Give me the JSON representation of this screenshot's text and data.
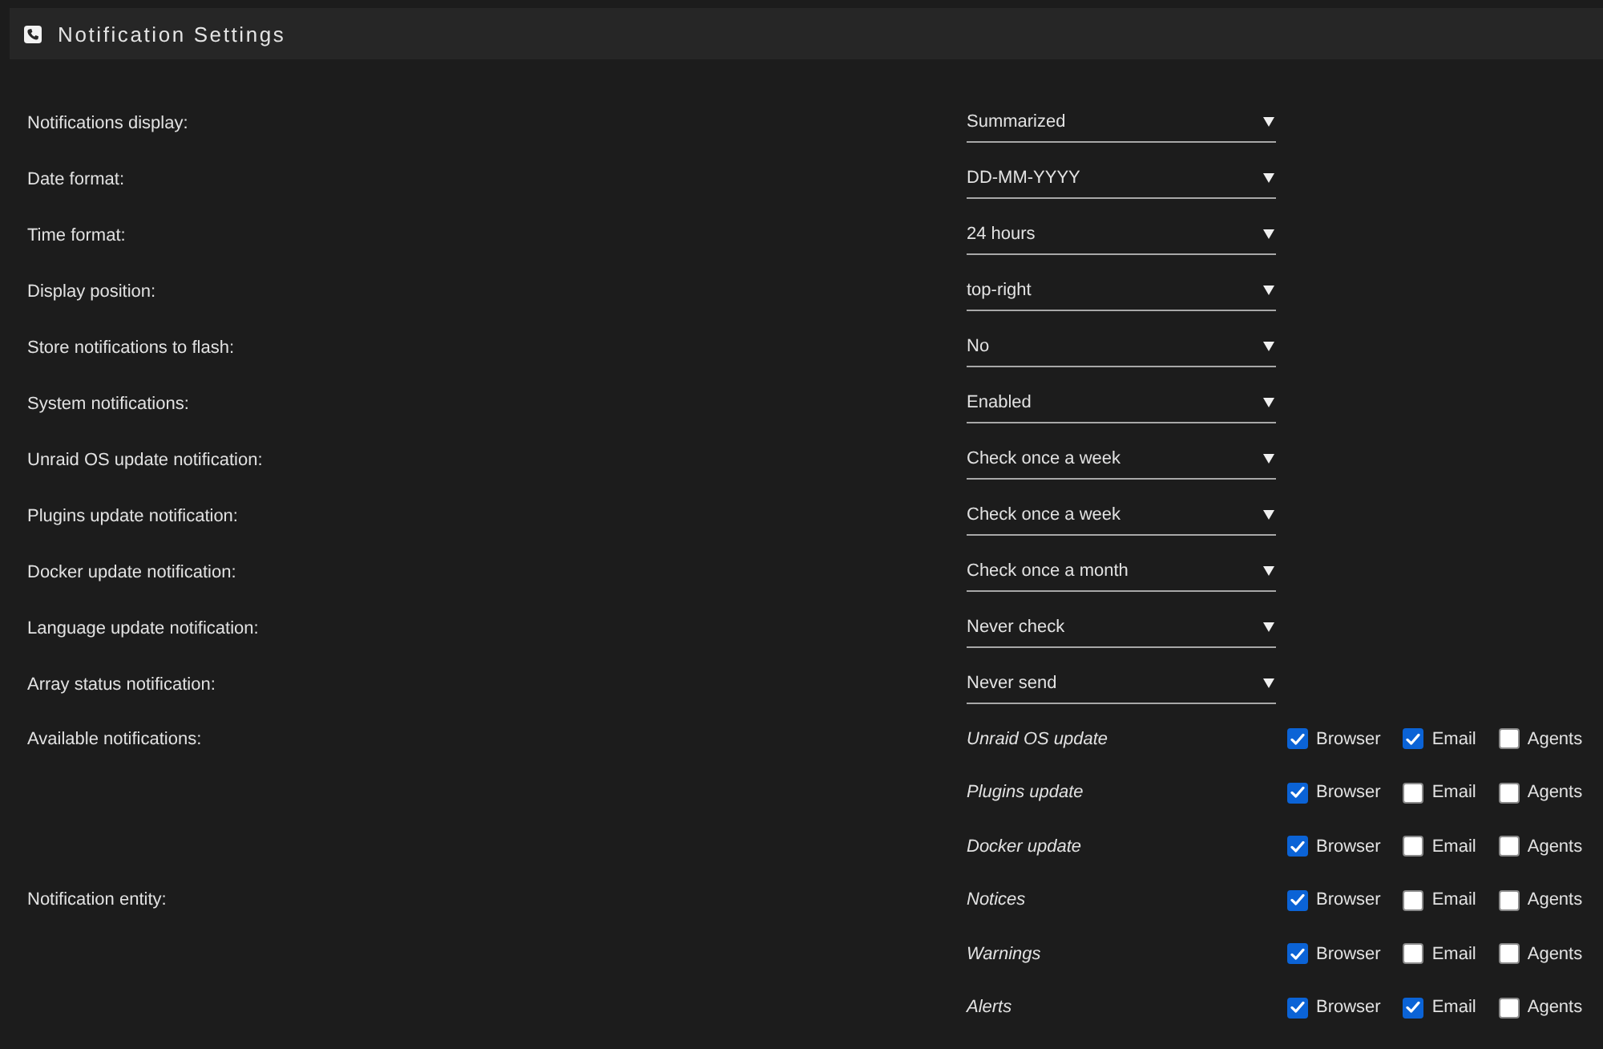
{
  "header": {
    "title": "Notification Settings"
  },
  "settings": [
    {
      "label": "Notifications display:",
      "value": "Summarized"
    },
    {
      "label": "Date format:",
      "value": "DD-MM-YYYY"
    },
    {
      "label": "Time format:",
      "value": "24 hours"
    },
    {
      "label": "Display position:",
      "value": "top-right"
    },
    {
      "label": "Store notifications to flash:",
      "value": "No"
    },
    {
      "label": "System notifications:",
      "value": "Enabled"
    },
    {
      "label": "Unraid OS update notification:",
      "value": "Check once a week"
    },
    {
      "label": "Plugins update notification:",
      "value": "Check once a week"
    },
    {
      "label": "Docker update notification:",
      "value": "Check once a month"
    },
    {
      "label": "Language update notification:",
      "value": "Never check"
    },
    {
      "label": "Array status notification:",
      "value": "Never send"
    }
  ],
  "notification_groups": [
    {
      "label": "Available notifications:",
      "items": [
        {
          "name": "Unraid OS update",
          "channels": [
            {
              "label": "Browser",
              "checked": true
            },
            {
              "label": "Email",
              "checked": true
            },
            {
              "label": "Agents",
              "checked": false
            }
          ]
        },
        {
          "name": "Plugins update",
          "channels": [
            {
              "label": "Browser",
              "checked": true
            },
            {
              "label": "Email",
              "checked": false
            },
            {
              "label": "Agents",
              "checked": false
            }
          ]
        },
        {
          "name": "Docker update",
          "channels": [
            {
              "label": "Browser",
              "checked": true
            },
            {
              "label": "Email",
              "checked": false
            },
            {
              "label": "Agents",
              "checked": false
            }
          ]
        }
      ]
    },
    {
      "label": "Notification entity:",
      "items": [
        {
          "name": "Notices",
          "channels": [
            {
              "label": "Browser",
              "checked": true
            },
            {
              "label": "Email",
              "checked": false
            },
            {
              "label": "Agents",
              "checked": false
            }
          ]
        },
        {
          "name": "Warnings",
          "channels": [
            {
              "label": "Browser",
              "checked": true
            },
            {
              "label": "Email",
              "checked": false
            },
            {
              "label": "Agents",
              "checked": false
            }
          ]
        },
        {
          "name": "Alerts",
          "channels": [
            {
              "label": "Browser",
              "checked": true
            },
            {
              "label": "Email",
              "checked": true
            },
            {
              "label": "Agents",
              "checked": false
            }
          ]
        }
      ]
    }
  ]
}
